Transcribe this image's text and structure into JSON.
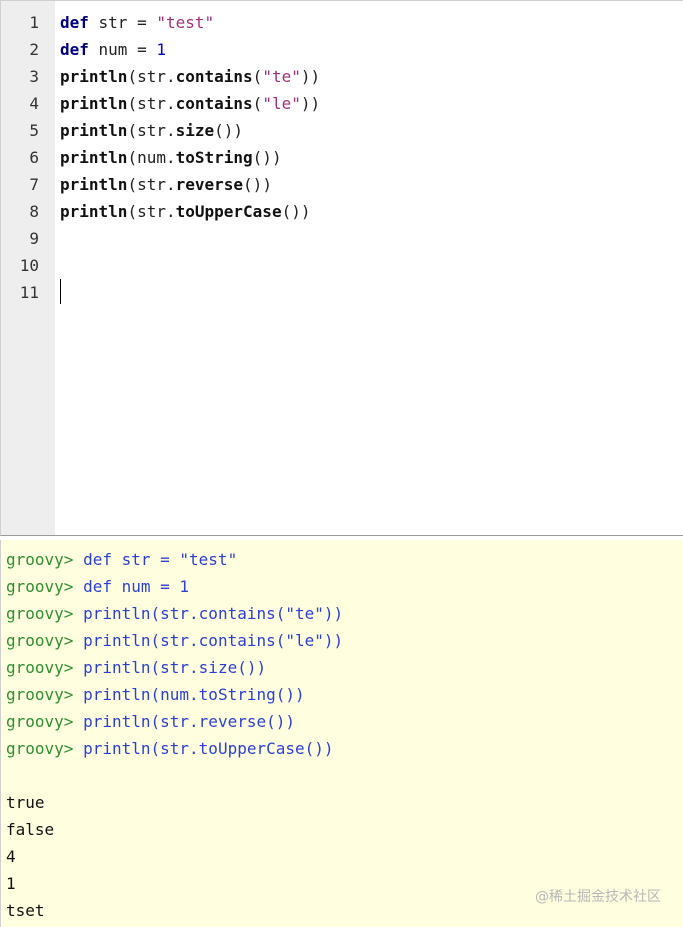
{
  "editor": {
    "line_numbers": [
      "1",
      "2",
      "3",
      "4",
      "5",
      "6",
      "7",
      "8",
      "9",
      "10",
      "11"
    ],
    "lines": [
      [
        {
          "t": "def",
          "c": "kw"
        },
        {
          "t": " str = ",
          "c": "plain"
        },
        {
          "t": "\"test\"",
          "c": "str"
        }
      ],
      [
        {
          "t": "def",
          "c": "kw"
        },
        {
          "t": " num = ",
          "c": "plain"
        },
        {
          "t": "1",
          "c": "num"
        }
      ],
      [
        {
          "t": "println",
          "c": "fn"
        },
        {
          "t": "(str.",
          "c": "plain"
        },
        {
          "t": "contains",
          "c": "fn"
        },
        {
          "t": "(",
          "c": "plain"
        },
        {
          "t": "\"te\"",
          "c": "str"
        },
        {
          "t": "))",
          "c": "plain"
        }
      ],
      [
        {
          "t": "println",
          "c": "fn"
        },
        {
          "t": "(str.",
          "c": "plain"
        },
        {
          "t": "contains",
          "c": "fn"
        },
        {
          "t": "(",
          "c": "plain"
        },
        {
          "t": "\"le\"",
          "c": "str"
        },
        {
          "t": "))",
          "c": "plain"
        }
      ],
      [
        {
          "t": "println",
          "c": "fn"
        },
        {
          "t": "(str.",
          "c": "plain"
        },
        {
          "t": "size",
          "c": "fn"
        },
        {
          "t": "())",
          "c": "plain"
        }
      ],
      [
        {
          "t": "println",
          "c": "fn"
        },
        {
          "t": "(num.",
          "c": "plain"
        },
        {
          "t": "toString",
          "c": "fn"
        },
        {
          "t": "())",
          "c": "plain"
        }
      ],
      [
        {
          "t": "println",
          "c": "fn"
        },
        {
          "t": "(str.",
          "c": "plain"
        },
        {
          "t": "reverse",
          "c": "fn"
        },
        {
          "t": "())",
          "c": "plain"
        }
      ],
      [
        {
          "t": "println",
          "c": "fn"
        },
        {
          "t": "(str.",
          "c": "plain"
        },
        {
          "t": "toUpperCase",
          "c": "fn"
        },
        {
          "t": "())",
          "c": "plain"
        }
      ]
    ]
  },
  "console": {
    "prompt": "groovy>",
    "commands": [
      "def str = \"test\"",
      "def num = 1",
      "println(str.contains(\"te\"))",
      "println(str.contains(\"le\"))",
      "println(str.size())",
      "println(num.toString())",
      "println(str.reverse())",
      "println(str.toUpperCase())"
    ],
    "output": [
      "true",
      "false",
      "4",
      "1",
      "tset"
    ]
  },
  "watermark": "@稀土掘金技术社区"
}
